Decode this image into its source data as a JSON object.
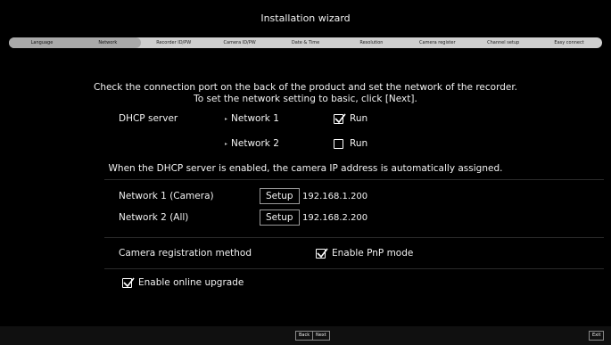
{
  "window": {
    "title": "Installation wizard"
  },
  "steps": [
    "Language",
    "Network",
    "Recorder ID/PW",
    "Camera ID/PW",
    "Date & Time",
    "Resolution",
    "Camera register",
    "Channel setup",
    "Easy connect"
  ],
  "current_step": "Network",
  "instructions": {
    "line1": "Check the connection port on the back of the product and set the network of the recorder.",
    "line2": "To set the network setting to basic, click [Next]."
  },
  "dhcp": {
    "label": "DHCP server",
    "network1": {
      "label": "Network 1",
      "run_label": "Run",
      "checked": true
    },
    "network2": {
      "label": "Network 2",
      "run_label": "Run",
      "checked": false
    },
    "note": "When the DHCP server is enabled, the camera IP address is automatically assigned."
  },
  "networks": [
    {
      "label": "Network 1 (Camera)",
      "button": "Setup",
      "ip": "192.168.1.200"
    },
    {
      "label": "Network 2 (All)",
      "button": "Setup",
      "ip": "192.168.2.200"
    }
  ],
  "registration": {
    "label": "Camera registration method",
    "pnp_label": "Enable PnP mode",
    "checked": true
  },
  "upgrade": {
    "label": "Enable online upgrade",
    "checked": true
  },
  "footer": {
    "back": "Back",
    "next": "Next",
    "exit": "Exit"
  }
}
